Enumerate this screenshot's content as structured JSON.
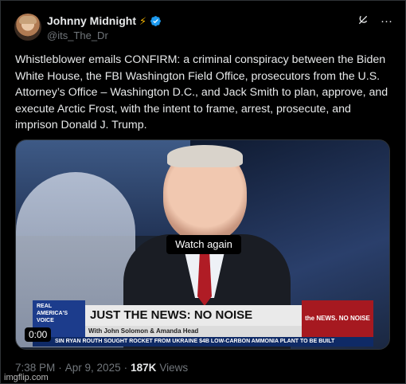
{
  "author": {
    "name": "Johnny Midnight",
    "badge_emoji": "⚡",
    "handle": "@its_The_Dr",
    "avatar_icon": "avatar-photo",
    "verified_color": "#1d9bf0"
  },
  "header_icons": [
    "grok-icon",
    "more-icon"
  ],
  "tweet": {
    "text": "Whistleblower emails CONFIRM: a criminal conspiracy between the Biden White House, the FBI Washington Field Office, prosecutors from the U.S. Attorney’s Office – Washington D.C., and Jack Smith to plan, approve, and execute Arctic Frost, with the intent to frame, arrest, prosecute, and imprison Donald J. Trump."
  },
  "video": {
    "overlay_label": "Watch again",
    "timecode": "0:00",
    "chyron": {
      "logo_text": "REAL AMERICA'S VOICE",
      "headline": "JUST THE NEWS: NO NOISE",
      "subline": "With John Solomon & Amanda Head",
      "brand": "the NEWS. NO NOISE",
      "ticker": "SIN RYAN ROUTH SOUGHT ROCKET FROM UKRAINE   $4B LOW-CARBON AMMONIA PLANT TO BE BUILT"
    }
  },
  "meta": {
    "time": "7:38 PM",
    "separator": "·",
    "date": "Apr 9, 2025",
    "views_count": "187K",
    "views_label": "Views"
  },
  "watermark": "imgflip.com"
}
